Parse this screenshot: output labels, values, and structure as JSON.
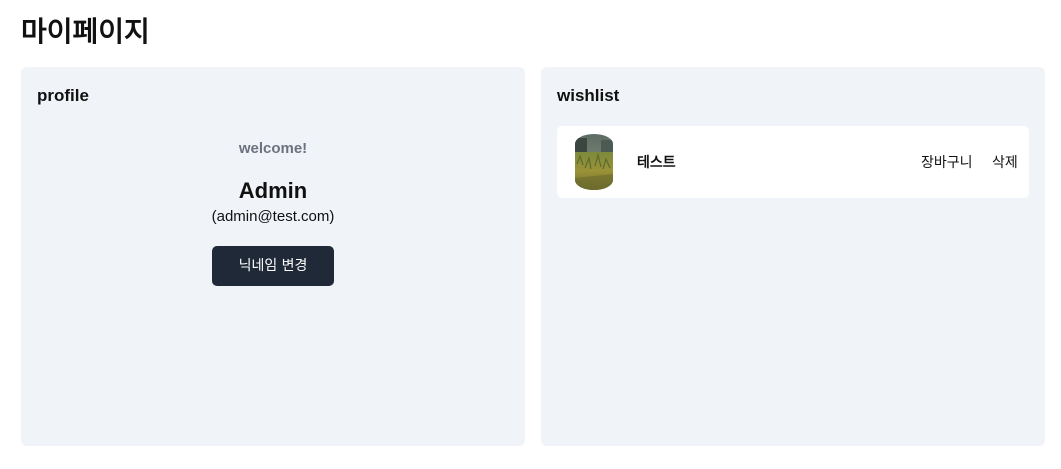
{
  "page": {
    "title": "마이페이지"
  },
  "profile": {
    "title": "profile",
    "welcome": "welcome!",
    "username": "Admin",
    "email": "(admin@test.com)",
    "change_nickname_label": "닉네임 변경"
  },
  "wishlist": {
    "title": "wishlist",
    "items": [
      {
        "name": "테스트",
        "cart_label": "장바구니",
        "delete_label": "삭제",
        "thumbnail": "grass-field-photo"
      }
    ]
  },
  "colors": {
    "panel_bg": "#f0f3f8",
    "button_bg": "#1f2937",
    "muted_text": "#6b7280"
  }
}
